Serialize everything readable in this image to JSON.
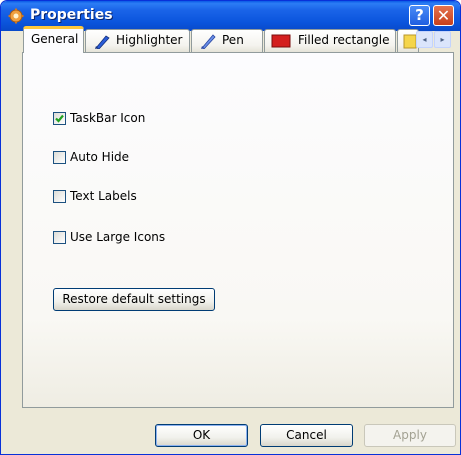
{
  "window": {
    "title": "Properties",
    "help_label": "?",
    "close_label": "✕"
  },
  "tabs": [
    {
      "label": "General",
      "icon": "none",
      "active": true
    },
    {
      "label": "Highlighter",
      "icon": "highlighter-icon",
      "active": false
    },
    {
      "label": "Pen",
      "icon": "pen-icon",
      "active": false
    },
    {
      "label": "Filled rectangle",
      "icon": "filled-rectangle-icon",
      "active": false
    },
    {
      "label": "",
      "icon": "partial-tab-icon",
      "active": false
    }
  ],
  "tab_scroll": {
    "left": "◂",
    "right": "▸"
  },
  "options": [
    {
      "label": "TaskBar Icon",
      "checked": true
    },
    {
      "label": "Auto Hide",
      "checked": false
    },
    {
      "label": "Text Labels",
      "checked": false
    },
    {
      "label": "Use Large Icons",
      "checked": false
    }
  ],
  "restore_button": "Restore default settings",
  "buttons": {
    "ok": "OK",
    "cancel": "Cancel",
    "apply": "Apply"
  },
  "colors": {
    "titlebar": "#0a5ae6",
    "active_tab_accent": "#ffc83c",
    "checkmark": "#21a121",
    "highlighter": "#2a5cd8",
    "filled_rectangle": "#d41f1f"
  }
}
